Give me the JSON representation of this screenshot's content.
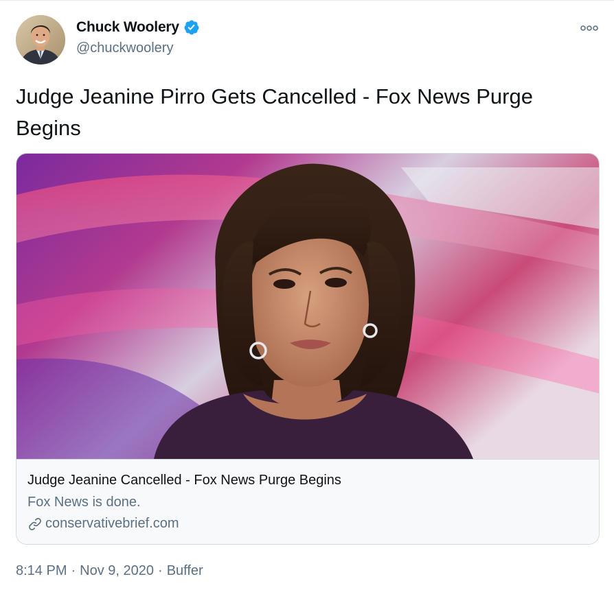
{
  "author": {
    "name": "Chuck Woolery",
    "handle": "@chuckwoolery",
    "verified": true,
    "avatar_icon": "person-avatar"
  },
  "more_icon": "more-horizontal-icon",
  "tweet": {
    "text": "Judge Jeanine Pirro Gets Cancelled - Fox News Purge Begins"
  },
  "card": {
    "image_icon": "news-photo",
    "title": "Judge Jeanine Cancelled - Fox News Purge Begins",
    "description": "Fox News is done.",
    "domain": "conservativebrief.com",
    "domain_icon": "link-icon"
  },
  "meta": {
    "time": "8:14 PM",
    "separator1": "·",
    "date": "Nov 9, 2020",
    "separator2": "·",
    "source": "Buffer"
  },
  "colors": {
    "verified_blue": "#1da1f2",
    "secondary_text": "#5b7083",
    "card_border": "#cfd9de"
  }
}
